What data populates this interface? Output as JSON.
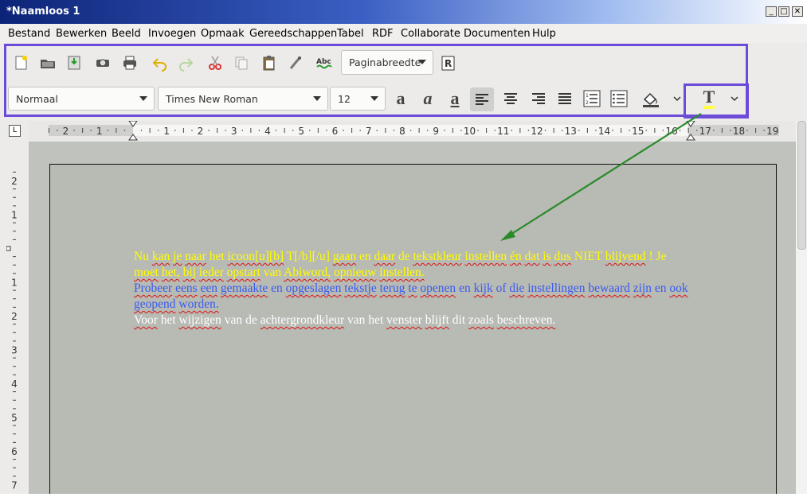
{
  "window": {
    "title": "*Naamloos 1",
    "minimize": "_",
    "maximize": "□",
    "close": "✕"
  },
  "menu": [
    "Bestand",
    "Bewerken",
    "Beeld",
    "Invoegen",
    "Opmaak",
    "Gereedschappen",
    "Tabel",
    "RDF",
    "Collaborate",
    "Documenten",
    "Hulp"
  ],
  "toolbar": {
    "zoom_value": "Paginabreedte",
    "style_value": "Normaal",
    "font_value": "Times New Roman",
    "size_value": "12",
    "bold_glyph": "a",
    "italic_glyph": "a",
    "underline_glyph": "a",
    "text_color_glyph": "T"
  },
  "ruler": {
    "horizontal_labels": [
      "2",
      "1",
      "1",
      "2",
      "3",
      "4",
      "5",
      "6",
      "7",
      "8",
      "9",
      "10",
      "11",
      "12",
      "13",
      "14",
      "15",
      "16",
      "17",
      "18",
      "19"
    ],
    "vertical_labels": [
      "2",
      "1",
      "1",
      "2",
      "3",
      "4",
      "5",
      "6",
      "7"
    ]
  },
  "document": {
    "paragraphs": [
      {
        "color": "#ffff00",
        "text": "Nu kan je naar het icoon[u][b] T[/b][/u] gaan en daar de tekstkleur instellen én dat is dus NIET blijvend ! Je moet het, bij ieder opstart van Abiword, opnieuw instellen."
      },
      {
        "color": "#3a5cf0",
        "text": "Probeer eens een gemaakte en opgeslagen tekstje terug te openen en kijk of die instellingen bewaard zijn en ook geopend worden."
      },
      {
        "color": "#ffffff",
        "text": "Voor het wijzigen van de achtergrondkleur van het venster blijft dit zoals beschreven."
      }
    ]
  },
  "colors": {
    "highlight_box": "#6c4bd8",
    "arrow": "#2a8a2a",
    "page_bg": "#b8bab4"
  }
}
